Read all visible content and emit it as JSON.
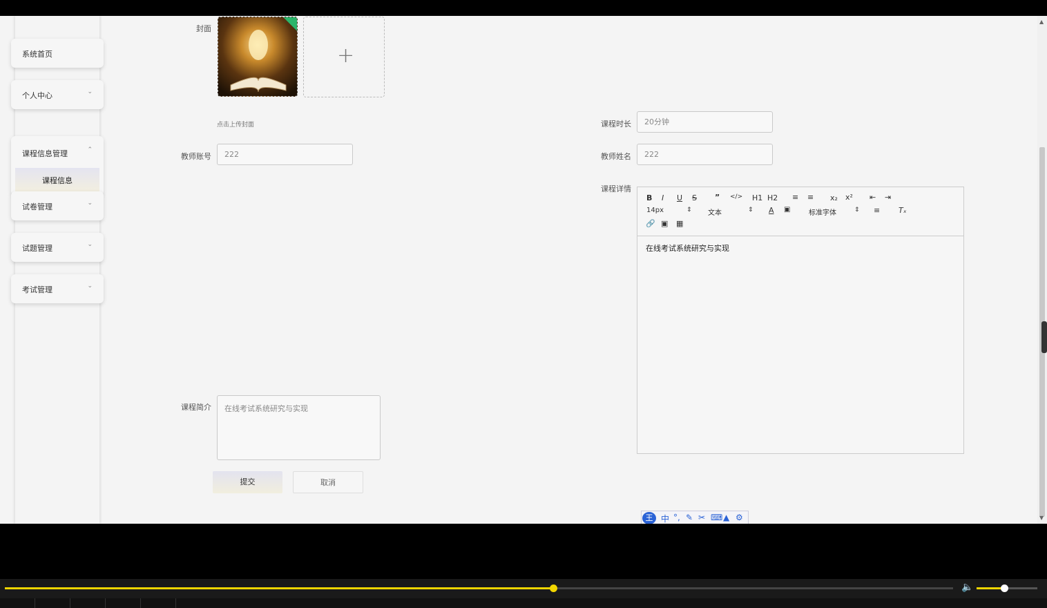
{
  "sidebar": {
    "items": [
      {
        "label": "系统首页"
      },
      {
        "label": "个人中心"
      },
      {
        "label": "课程信息管理",
        "sub": "课程信息"
      },
      {
        "label": "试卷管理"
      },
      {
        "label": "试题管理"
      },
      {
        "label": "考试管理"
      }
    ]
  },
  "form": {
    "cover_label": "封面",
    "cover_hint": "点击上传封面",
    "teacher_account_label": "教师账号",
    "teacher_account_value": "222",
    "duration_label": "课程时长",
    "duration_value": "20分钟",
    "teacher_name_label": "教师姓名",
    "teacher_name_value": "222",
    "detail_label": "课程详情",
    "intro_label": "课程简介",
    "intro_value": "在线考试系统研究与实现",
    "submit_label": "提交",
    "cancel_label": "取消"
  },
  "editor": {
    "font_size": "14px",
    "paragraph": "文本",
    "font_family": "标准字体",
    "content": "在线考试系统研究与实现",
    "h1": "H1",
    "h2": "H2"
  },
  "ime": {
    "logo": "王",
    "mode": "中"
  },
  "player": {
    "progress": 0.578,
    "volume": 0.45
  },
  "colors": {
    "accent": "#f2d600",
    "ime_blue": "#2a62d6",
    "badge_green": "#2bb56b"
  }
}
